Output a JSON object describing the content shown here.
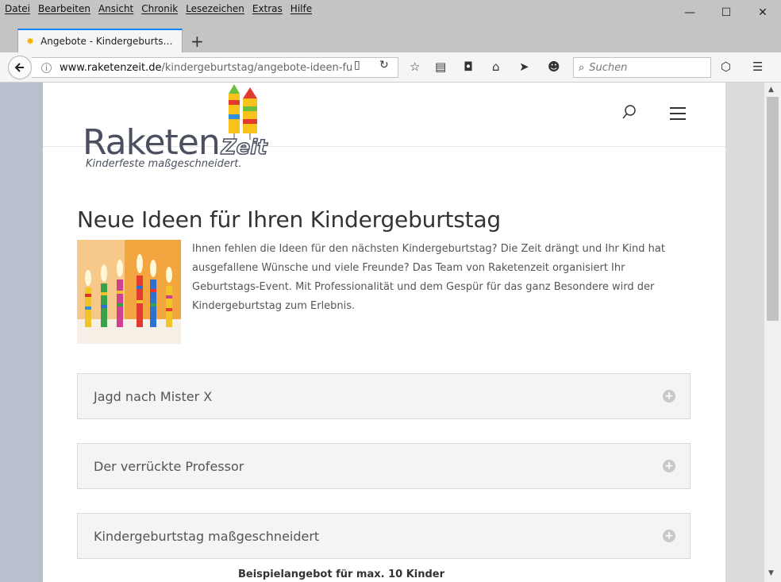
{
  "menu": [
    "Datei",
    "Bearbeiten",
    "Ansicht",
    "Chronik",
    "Lesezeichen",
    "Extras",
    "Hilfe"
  ],
  "window_controls": {
    "minimize": "—",
    "maximize": "☐",
    "close": "✕"
  },
  "tab": {
    "title": "Angebote - Kindergeburts…",
    "new_tab_label": "+"
  },
  "url": {
    "domain": "www.raketenzeit.de",
    "path": "/kindergeburtstag/angebote-ideen-fu"
  },
  "search": {
    "placeholder": "Suchen"
  },
  "site": {
    "logo_main": "Raketen",
    "logo_accent": "Zeit",
    "logo_tagline": "Kinderfeste maßgeschneidert."
  },
  "main": {
    "heading": "Neue Ideen für Ihren Kindergeburtstag",
    "intro": "Ihnen fehlen die Ideen für den nächsten Kindergeburtstag? Die Zeit drängt und Ihr Kind hat ausgefallene Wünsche und viele Freunde? Das Team von Raketenzeit organisiert Ihr Geburtstags-Event. Mit Professionalität und dem Gespür für das ganz Besondere wird der Kindergeburtstag zum Erlebnis.",
    "accordion": [
      {
        "title": "Jagd nach Mister X"
      },
      {
        "title": "Der verrückte Professor"
      },
      {
        "title": "Kindergeburtstag maßgeschneidert"
      }
    ],
    "partial_text": "Beispielangebot für max. 10 Kinder"
  },
  "colors": {
    "accent": "#0a84ff",
    "logo": "#4a5060",
    "page_bg": "#b9bfcc"
  }
}
